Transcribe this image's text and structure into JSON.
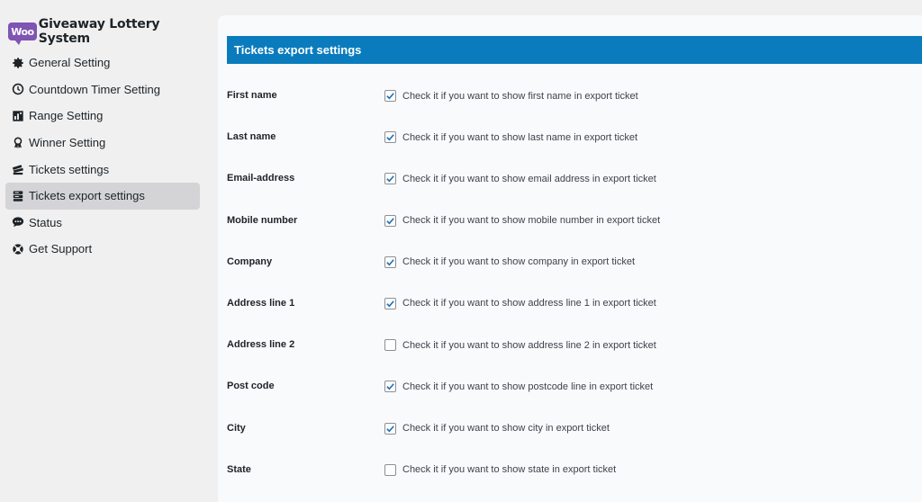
{
  "brand": {
    "logo_text": "Woo",
    "title": "Giveaway Lottery System"
  },
  "menu": [
    {
      "label": "General Setting",
      "icon": "gear-icon",
      "active": false
    },
    {
      "label": "Countdown Timer Setting",
      "icon": "clock-icon",
      "active": false
    },
    {
      "label": "Range Setting",
      "icon": "range-icon",
      "active": false
    },
    {
      "label": "Winner Setting",
      "icon": "award-icon",
      "active": false
    },
    {
      "label": "Tickets settings",
      "icon": "tickets-icon",
      "active": false
    },
    {
      "label": "Tickets export settings",
      "icon": "export-icon",
      "active": true
    },
    {
      "label": "Status",
      "icon": "chat-icon",
      "active": false
    },
    {
      "label": "Get Support",
      "icon": "lifebuoy-icon",
      "active": false
    }
  ],
  "panel": {
    "title": "Tickets export settings",
    "rows": [
      {
        "label": "First name",
        "desc": "Check it if you want to show first name in export ticket",
        "checked": true
      },
      {
        "label": "Last name",
        "desc": "Check it if you want to show last name in export ticket",
        "checked": true
      },
      {
        "label": "Email-address",
        "desc": "Check it if you want to show email address in export ticket",
        "checked": true
      },
      {
        "label": "Mobile number",
        "desc": "Check it if you want to show mobile number in export ticket",
        "checked": true
      },
      {
        "label": "Company",
        "desc": "Check it if you want to show company in export ticket",
        "checked": true
      },
      {
        "label": "Address line 1",
        "desc": "Check it if you want to show address line 1 in export ticket",
        "checked": true
      },
      {
        "label": "Address line 2",
        "desc": "Check it if you want to show address line 2 in export ticket",
        "checked": false
      },
      {
        "label": "Post code",
        "desc": "Check it if you want to show postcode line in export ticket",
        "checked": true
      },
      {
        "label": "City",
        "desc": "Check it if you want to show city in export ticket",
        "checked": true
      },
      {
        "label": "State",
        "desc": "Check it if you want to show state in export ticket",
        "checked": false
      }
    ]
  },
  "colors": {
    "accent": "#0a7cbd",
    "check": "#2271b1",
    "woo_purple": "#7f54b3"
  }
}
